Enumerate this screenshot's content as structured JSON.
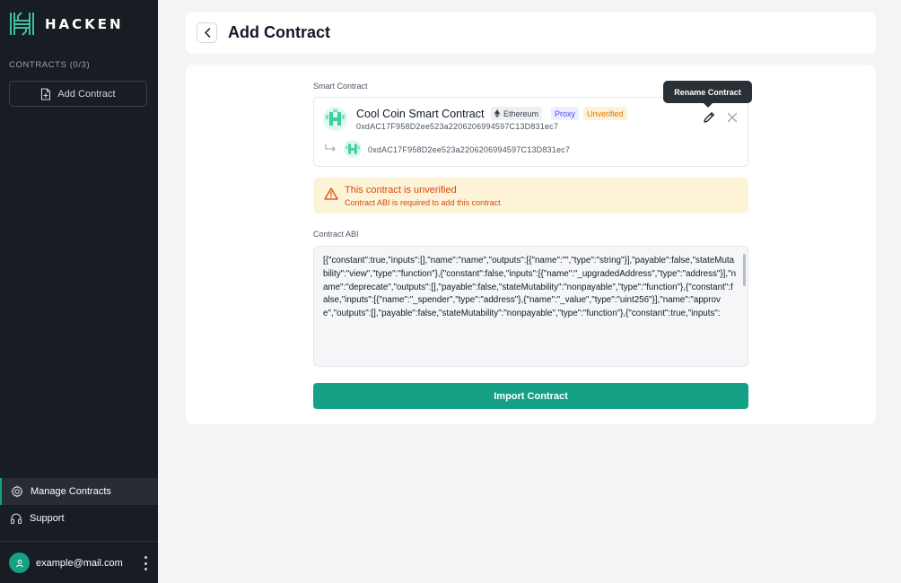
{
  "colors": {
    "sidebar_bg": "#181c23",
    "accent": "#16a085",
    "warning_bg": "#fdf3d6",
    "warning_text": "#d9480f"
  },
  "sidebar": {
    "logo_text": "HACKEN",
    "section_title": "CONTRACTS (0/3)",
    "add_button": "Add Contract",
    "nav": [
      {
        "label": "Manage Contracts",
        "icon": "gear-icon",
        "active": true
      },
      {
        "label": "Support",
        "icon": "headphones-icon",
        "active": false
      }
    ],
    "user_email": "example@mail.com"
  },
  "header": {
    "title": "Add Contract"
  },
  "form": {
    "smart_contract_label": "Smart Contract",
    "contract": {
      "name": "Cool Coin Smart Contract",
      "network": "Ethereum",
      "proxy_badge": "Proxy",
      "status_badge": "Unverified",
      "address": "0xdAC17F958D2ee523a2206206994597C13D831ec7",
      "implementation_address": "0xdAC17F958D2ee523a2206206994597C13D831ec7"
    },
    "tooltip": "Rename Contract",
    "warning": {
      "title": "This contract is unverified",
      "description": "Contract ABI is required to add this contract"
    },
    "abi_label": "Contract ABI",
    "abi_value": "[{\"constant\":true,\"inputs\":[],\"name\":\"name\",\"outputs\":[{\"name\":\"\",\"type\":\"string\"}],\"payable\":false,\"stateMutability\":\"view\",\"type\":\"function\"},{\"constant\":false,\"inputs\":[{\"name\":\"_upgradedAddress\",\"type\":\"address\"}],\"name\":\"deprecate\",\"outputs\":[],\"payable\":false,\"stateMutability\":\"nonpayable\",\"type\":\"function\"},{\"constant\":false,\"inputs\":[{\"name\":\"_spender\",\"type\":\"address\"},{\"name\":\"_value\",\"type\":\"uint256\"}],\"name\":\"approve\",\"outputs\":[],\"payable\":false,\"stateMutability\":\"nonpayable\",\"type\":\"function\"},{\"constant\":true,\"inputs\":",
    "import_button": "Import Contract"
  }
}
